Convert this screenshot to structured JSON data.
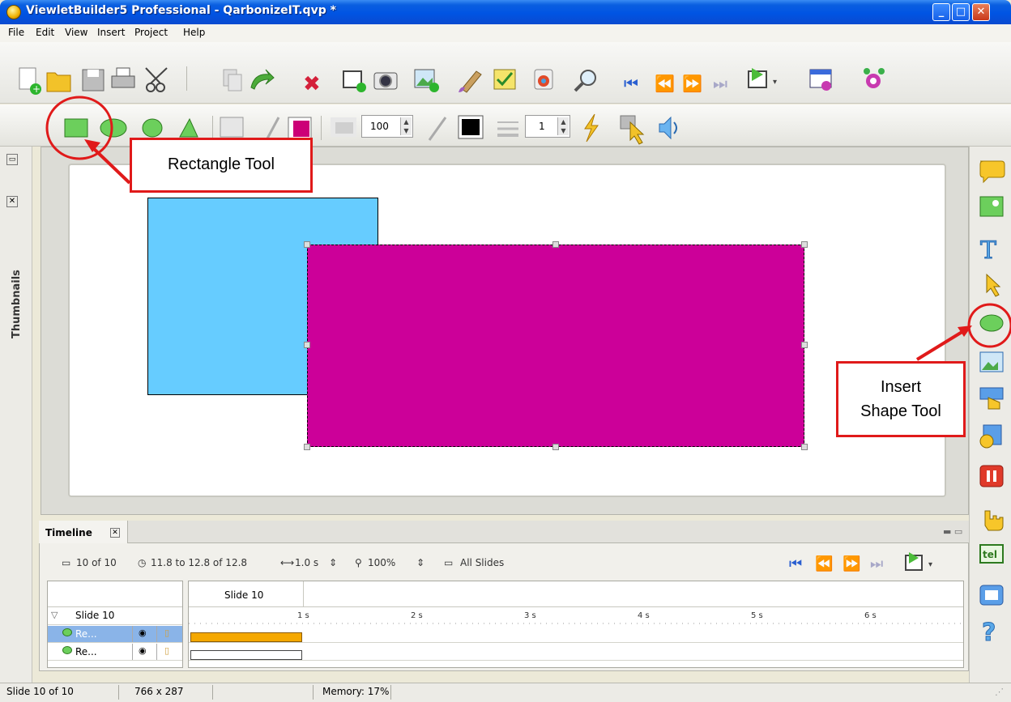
{
  "window": {
    "title": "ViewletBuilder5 Professional - QarbonizeIT.qvp *",
    "minimize": "_",
    "maximize": "□",
    "close": "✕"
  },
  "menu": {
    "file": "File",
    "edit": "Edit",
    "view": "View",
    "insert": "Insert",
    "project": "Project",
    "help": "Help"
  },
  "toolbar2": {
    "opacity_value": "100",
    "line_width_value": "1"
  },
  "left_panel": {
    "tab_label": "Thumbnails"
  },
  "stage": {
    "rect1_color": "#66ccff",
    "rect2_color": "#cc0099"
  },
  "timeline": {
    "tab_label": "Timeline",
    "slide_position": "10 of 10",
    "time_range": "11.8 to 12.8 of 12.8",
    "duration": "1.0 s",
    "zoom": "100%",
    "all_slides": "All Slides",
    "slide_header": "Slide 10",
    "tree_slide": "Slide 10",
    "ruler": [
      "1 s",
      "2 s",
      "3 s",
      "4 s",
      "5 s",
      "6 s"
    ],
    "rows": [
      {
        "label": "Re...",
        "bar_color": "#f5a800"
      },
      {
        "label": "Re...",
        "bar_color": "#ffffff"
      }
    ]
  },
  "status": {
    "slide": "Slide 10 of 10",
    "size": "766 x 287",
    "memory": "Memory: 17%"
  },
  "annotations": {
    "rectangle_tool": "Rectangle Tool",
    "insert_shape_line1": "Insert",
    "insert_shape_line2": "Shape Tool",
    "accent": "#e01a1a"
  }
}
